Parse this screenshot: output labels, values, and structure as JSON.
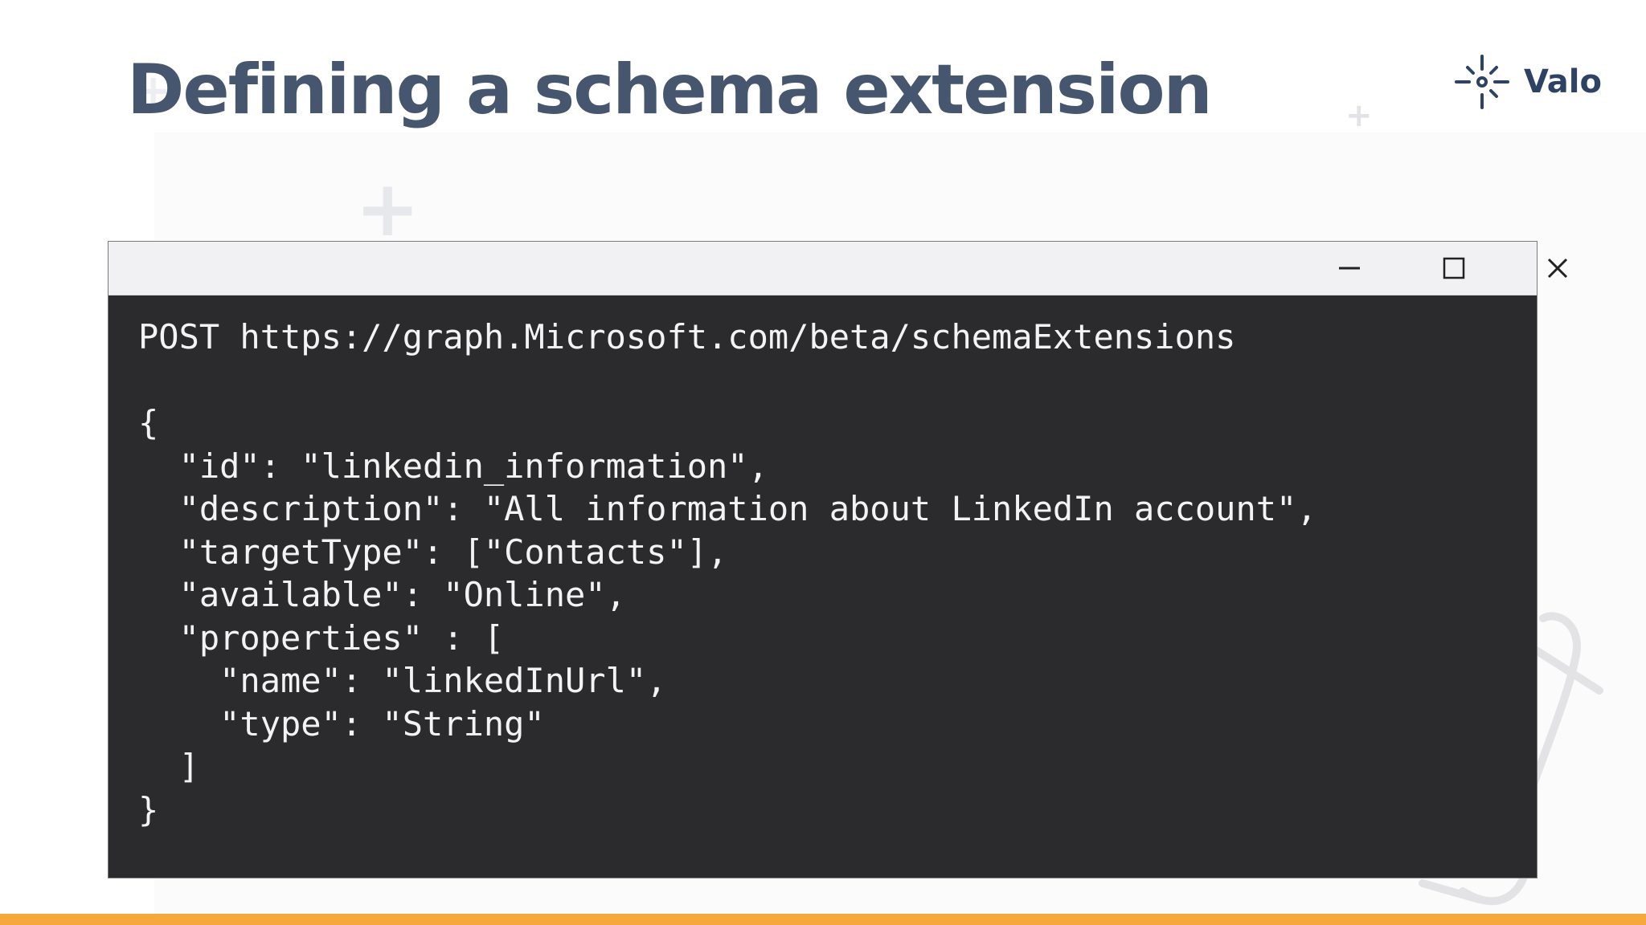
{
  "slide": {
    "title": "Defining a schema extension"
  },
  "brand": {
    "logo_text": "Valo",
    "logo_icon": "sparkle-target-icon",
    "text_color": "#2e4263"
  },
  "window": {
    "controls": {
      "minimize_icon": "minimize-icon",
      "maximize_icon": "maximize-icon",
      "close_icon": "close-icon"
    },
    "code_lines": [
      "POST https://graph.Microsoft.com/beta/schemaExtensions",
      "",
      "{",
      "  \"id\": \"linkedin_information\",",
      "  \"description\": \"All information about LinkedIn account\",",
      "  \"targetType\": [\"Contacts\"],",
      "  \"available\": \"Online\",",
      "  \"properties\" : [",
      "    \"name\": \"linkedInUrl\",",
      "    \"type\": \"String\"",
      "  ]",
      "}"
    ]
  },
  "colors": {
    "title": "#46566f",
    "code_background": "#2b2b2d",
    "code_text": "#f3f3f3",
    "titlebar": "#f1f1f3",
    "accent_bar": "#f5a83b"
  }
}
